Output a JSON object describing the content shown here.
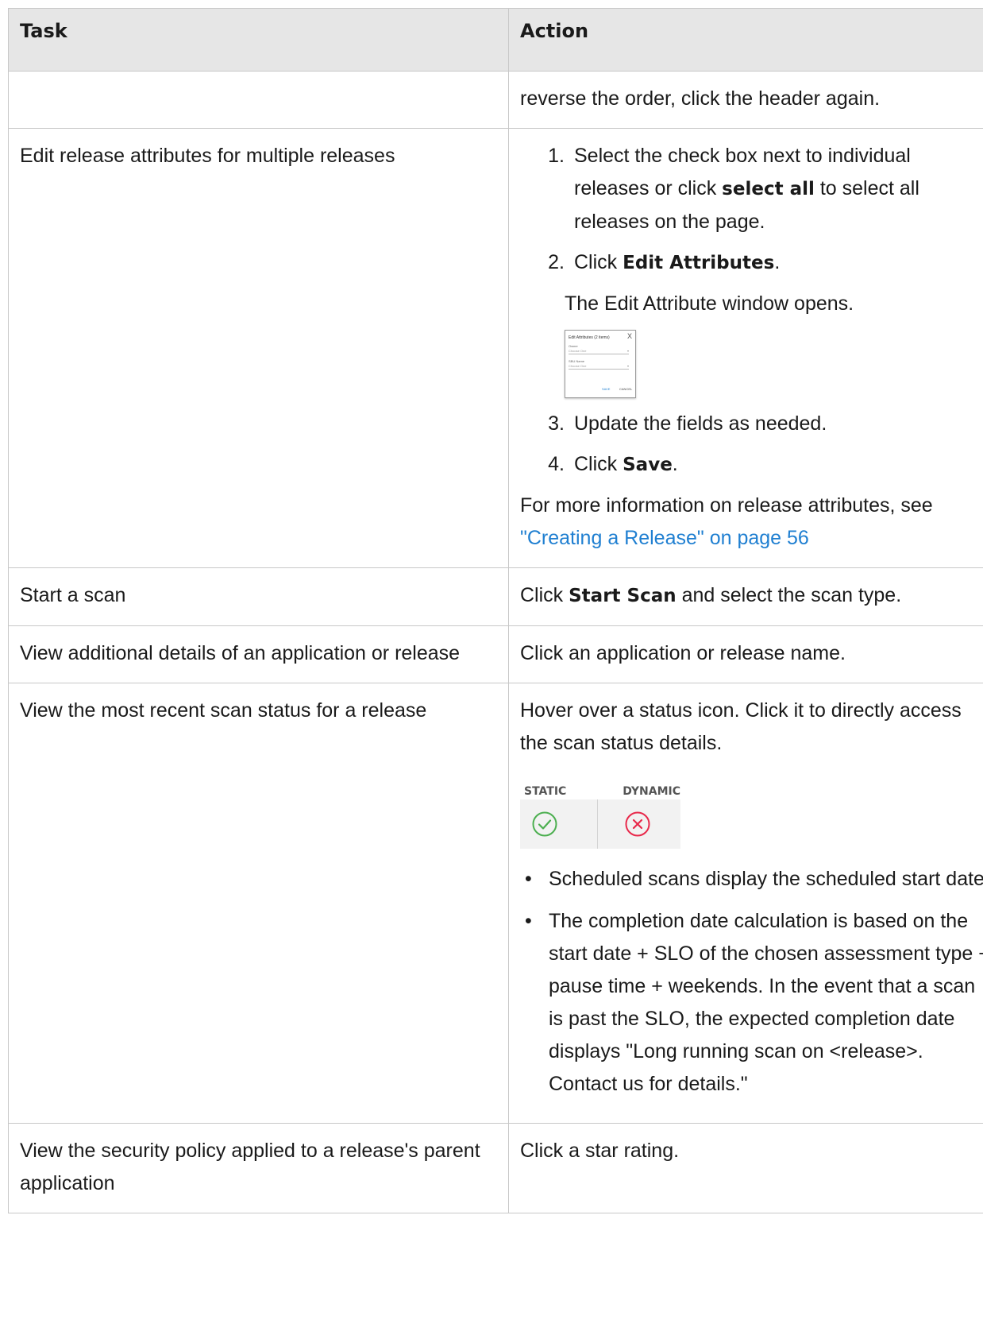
{
  "header": {
    "task": "Task",
    "action": "Action"
  },
  "row0": {
    "action": "reverse the order, click the header again."
  },
  "row1": {
    "task": "Edit release attributes for multiple releases",
    "step1": {
      "num": "1.",
      "pre": "Select the check box next to individual releases or click ",
      "bold": "select all",
      "post": " to select all releases on the page."
    },
    "step2": {
      "num": "2.",
      "pre": "Click ",
      "bold": "Edit Attributes",
      "post": "."
    },
    "step2_note": "The Edit Attribute window opens.",
    "dialog": {
      "title": "Edit Attributes (2 items)",
      "close": "X",
      "field1_label": "Owner",
      "field1_value": "Choose One",
      "field2_label": "SBU Name",
      "field2_value": "Choose One",
      "caret": "▾",
      "save": "SAVE",
      "cancel": "CANCEL"
    },
    "step3": {
      "num": "3.",
      "text": "Update the fields as needed."
    },
    "step4": {
      "num": "4.",
      "pre": "Click ",
      "bold": "Save",
      "post": "."
    },
    "more_pre": "For more information on release attributes, see ",
    "more_link": "\"Creating a Release\" on page 56"
  },
  "row2": {
    "task": "Start a scan",
    "pre": "Click ",
    "bold": "Start Scan",
    "post": " and select the scan type."
  },
  "row3": {
    "task": "View additional details of an application or release",
    "action": "Click an application or release name."
  },
  "row4": {
    "task": "View the most recent scan status for a release",
    "action": "Hover over a status icon. Click it to directly access the scan status details.",
    "widget": {
      "static_label": "STATIC",
      "dynamic_label": "DYNAMIC",
      "static_icon": "check-circle-icon",
      "dynamic_icon": "x-circle-icon",
      "success_color": "#4caf50",
      "fail_color": "#e8294b"
    },
    "bullet_char": "•",
    "bullet1": "Scheduled scans display the scheduled start date.",
    "bullet2": "The completion date calculation is based on the start date + SLO of the chosen assessment type + pause time + weekends. In the event that a scan is past the SLO, the expected completion date displays \"Long running scan on <release>. Contact us for details.\""
  },
  "row5": {
    "task": "View the security policy applied to a release's parent application",
    "action": "Click a star rating."
  }
}
